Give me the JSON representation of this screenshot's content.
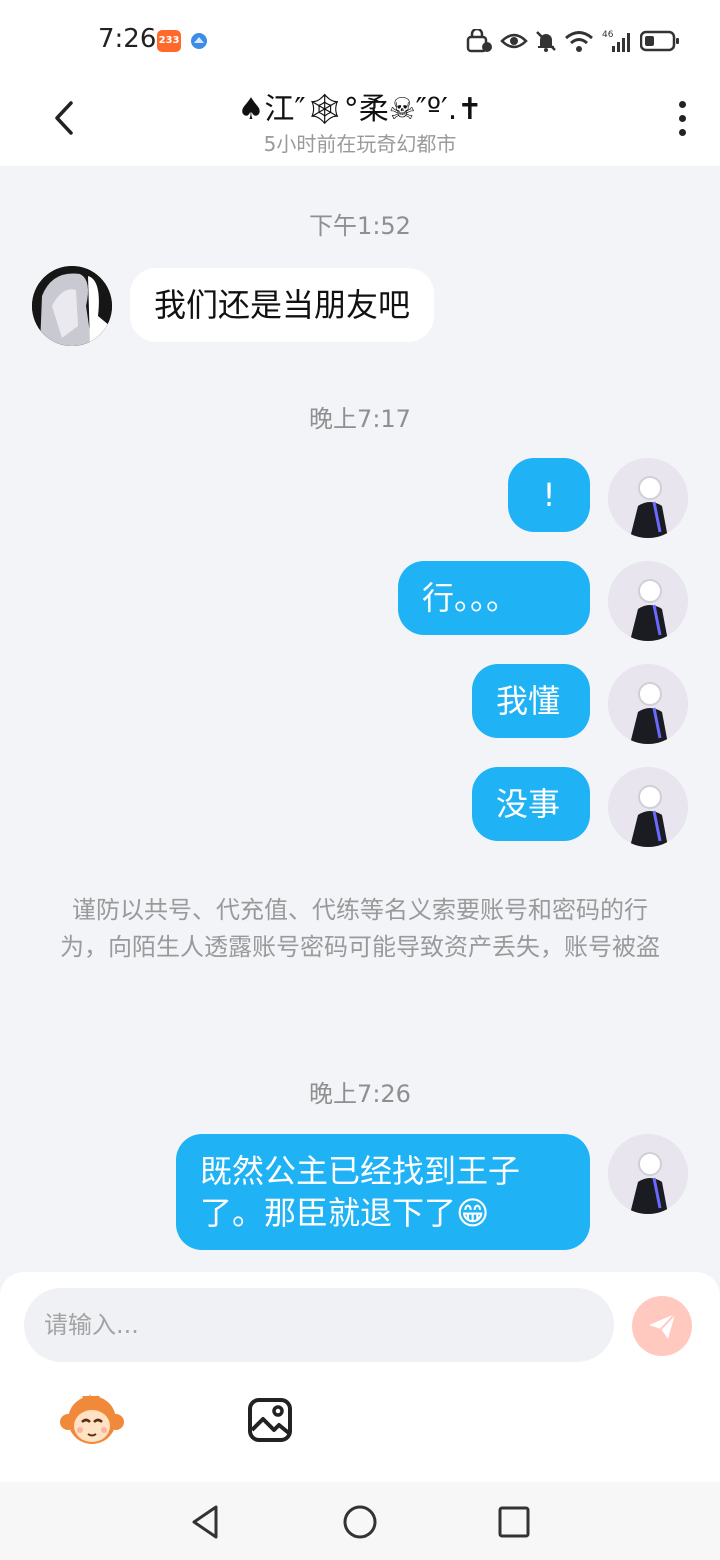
{
  "status_bar": {
    "time": "7:26",
    "badge": "233",
    "network": "46"
  },
  "header": {
    "title": "♠江″🕸°柔☠″º′.✝",
    "subtitle": "5小时前在玩奇幻都市"
  },
  "chat": {
    "time_1": "下午1:52",
    "incoming_1": "我们还是当朋友吧",
    "time_2": "晚上7:17",
    "outgoing_1": "!",
    "outgoing_2": "行。。。",
    "outgoing_3": "我懂",
    "outgoing_4": "没事",
    "notice": "谨防以共号、代充值、代练等名义索要账号和密码的行为，向陌生人透露账号密码可能导致资产丢失，账号被盗",
    "time_3": "晚上7:26",
    "outgoing_5": "既然公主已经找到王子了。那臣就退下了😁"
  },
  "input": {
    "placeholder": "请输入..."
  },
  "colors": {
    "outgoing_bubble": "#1fb2f5",
    "incoming_bubble": "#ffffff",
    "chat_background": "#f2f4f8",
    "send_button_inactive": "#ffc9c0"
  },
  "icons": {
    "back": "chevron-left-icon",
    "more": "more-vertical-icon",
    "send": "paper-plane-icon",
    "emoji": "monkey-emoji-icon",
    "image": "image-icon",
    "nav_back": "triangle-back-icon",
    "nav_home": "circle-home-icon",
    "nav_recent": "square-recent-icon"
  }
}
